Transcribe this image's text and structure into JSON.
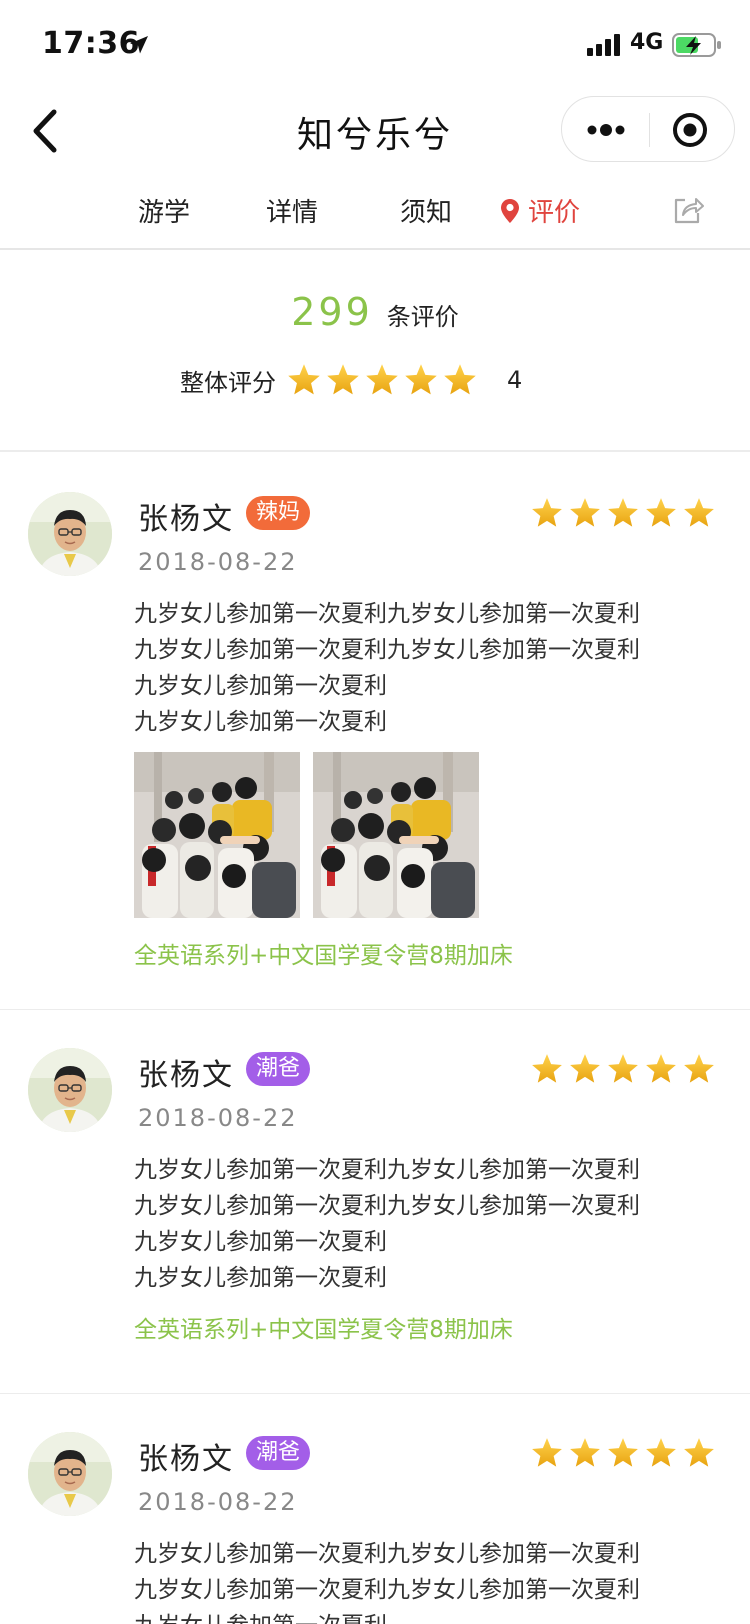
{
  "status_bar": {
    "time": "17:36",
    "network": "4G"
  },
  "nav": {
    "title": "知兮乐兮"
  },
  "tabs": [
    {
      "label": "游学",
      "active": false
    },
    {
      "label": "详情",
      "active": false
    },
    {
      "label": "须知",
      "active": false
    },
    {
      "label": "评价",
      "active": true
    }
  ],
  "summary": {
    "count": "299",
    "count_label": "条评价",
    "score_label": "整体评分",
    "stars": 5,
    "score": "4"
  },
  "reviews": [
    {
      "name": "张杨文",
      "badge": "辣妈",
      "badge_color": "#f26b3a",
      "date": "2018-08-22",
      "stars": 5,
      "text_lines": [
        "九岁女儿参加第一次夏利九岁女儿参加第一次夏利",
        "九岁女儿参加第一次夏利九岁女儿参加第一次夏利",
        "九岁女儿参加第一次夏利",
        "九岁女儿参加第一次夏利"
      ],
      "photo_count": 2,
      "tag": "全英语系列+中文国学夏令营8期加床"
    },
    {
      "name": "张杨文",
      "badge": "潮爸",
      "badge_color": "#a35ee8",
      "date": "2018-08-22",
      "stars": 5,
      "text_lines": [
        "九岁女儿参加第一次夏利九岁女儿参加第一次夏利",
        "九岁女儿参加第一次夏利九岁女儿参加第一次夏利",
        "九岁女儿参加第一次夏利",
        "九岁女儿参加第一次夏利"
      ],
      "photo_count": 0,
      "tag": "全英语系列+中文国学夏令营8期加床"
    },
    {
      "name": "张杨文",
      "badge": "潮爸",
      "badge_color": "#a35ee8",
      "date": "2018-08-22",
      "stars": 5,
      "text_lines": [
        "九岁女儿参加第一次夏利九岁女儿参加第一次夏利",
        "九岁女儿参加第一次夏利九岁女儿参加第一次夏利",
        "九岁女儿参加第一次夏利"
      ]
    }
  ],
  "colors": {
    "accent_green": "#8bc34a",
    "active_tab_red": "#e0443e",
    "star_gold": "#f5b820"
  }
}
